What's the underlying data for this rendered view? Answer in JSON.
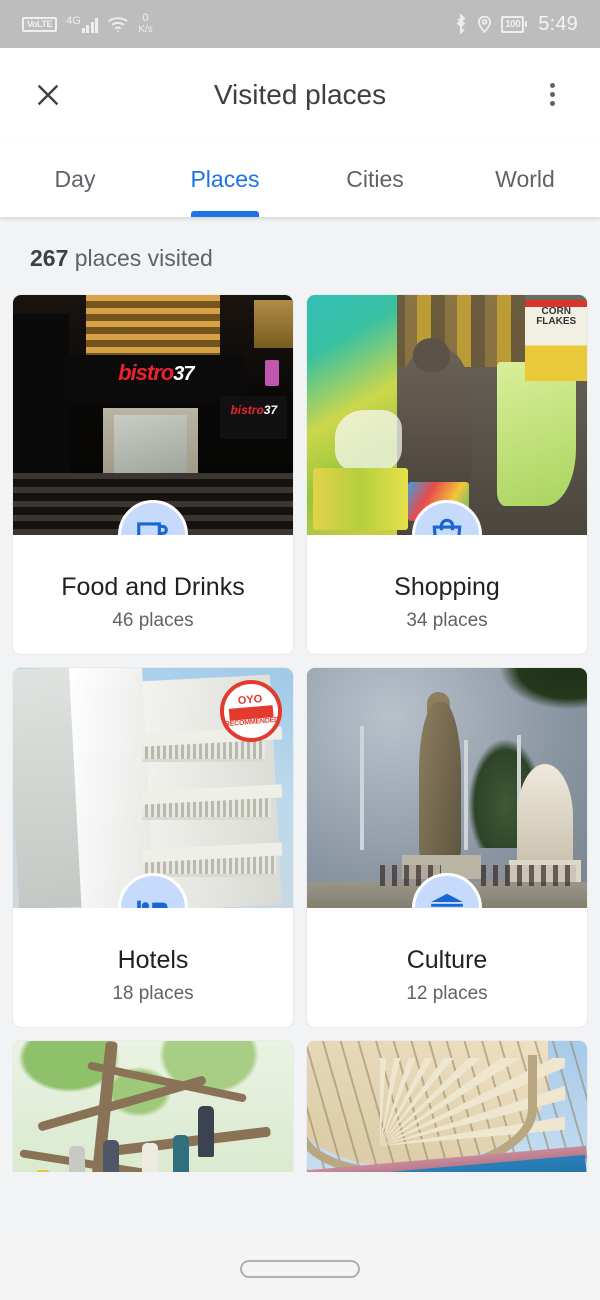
{
  "status_bar": {
    "volte_label": "VoLTE",
    "network_type": "4G",
    "data_speed_value": "0",
    "data_speed_unit": "K/s",
    "bluetooth_icon": "bluetooth-icon",
    "location_icon": "location-pin-icon",
    "wifi_icon": "wifi-icon",
    "battery_level": "100",
    "time": "5:49"
  },
  "app_bar": {
    "close_icon": "close-icon",
    "title": "Visited places",
    "overflow_icon": "more-vertical-icon"
  },
  "tabs": {
    "items": [
      {
        "label": "Day",
        "active": false
      },
      {
        "label": "Places",
        "active": true
      },
      {
        "label": "Cities",
        "active": false
      },
      {
        "label": "World",
        "active": false
      }
    ],
    "active_color": "#1a73e8",
    "inactive_color": "#5f6368"
  },
  "summary": {
    "count": "267",
    "text": " places visited"
  },
  "categories": [
    {
      "title": "Food and Drinks",
      "places": "46 places",
      "icon": "coffee-cup-icon",
      "photo_caption": "bistro",
      "photo_caption_number": "37"
    },
    {
      "title": "Shopping",
      "places": "34 places",
      "icon": "shopping-bag-icon",
      "photo_caption": "CORN FLAKES"
    },
    {
      "title": "Hotels",
      "places": "18 places",
      "icon": "bed-icon",
      "badge_brand": "OYO",
      "badge_text": "RECOMMENDED"
    },
    {
      "title": "Culture",
      "places": "12 places",
      "icon": "museum-icon"
    }
  ],
  "partial_categories": [
    {
      "icon": "tree-photo",
      "title": ""
    },
    {
      "icon": "stadium-photo",
      "title": ""
    }
  ],
  "nav_bar": {
    "gesture_pill": "home-gesture-pill"
  },
  "theme": {
    "accent": "#1a73e8",
    "badge_bg": "#c6dafc",
    "badge_icon": "#1967d2",
    "surface": "#ffffff",
    "background": "#f1f3f4",
    "text_primary": "#202124",
    "text_secondary": "#5f6368",
    "status_bar_bg": "#bdbdbd"
  }
}
